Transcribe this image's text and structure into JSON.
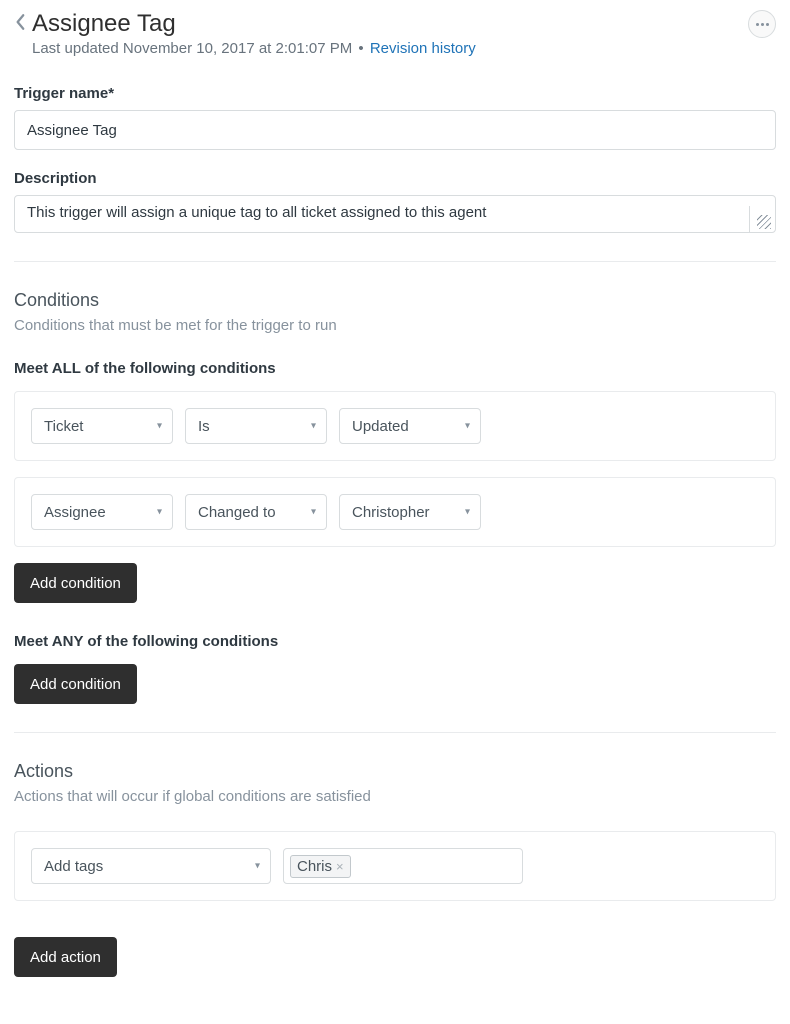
{
  "header": {
    "title": "Assignee Tag",
    "last_updated_prefix": "Last updated ",
    "last_updated_value": "November 10, 2017 at 2:01:07 PM",
    "revision_label": "Revision history"
  },
  "trigger_name": {
    "label": "Trigger name*",
    "value": "Assignee Tag"
  },
  "description": {
    "label": "Description",
    "value": "This trigger will assign a unique tag to all ticket assigned to this agent"
  },
  "conditions": {
    "title": "Conditions",
    "desc": "Conditions that must be met for the trigger to run",
    "all": {
      "label": "Meet ALL of the following conditions",
      "rows": [
        {
          "field": "Ticket",
          "operator": "Is",
          "value": "Updated"
        },
        {
          "field": "Assignee",
          "operator": "Changed to",
          "value": "Christopher"
        }
      ],
      "add_button": "Add condition"
    },
    "any": {
      "label": "Meet ANY of the following conditions",
      "add_button": "Add condition"
    }
  },
  "actions": {
    "title": "Actions",
    "desc": "Actions that will occur if global conditions are satisfied",
    "rows": [
      {
        "field": "Add tags",
        "tag": "Chris"
      }
    ],
    "add_button": "Add action"
  }
}
